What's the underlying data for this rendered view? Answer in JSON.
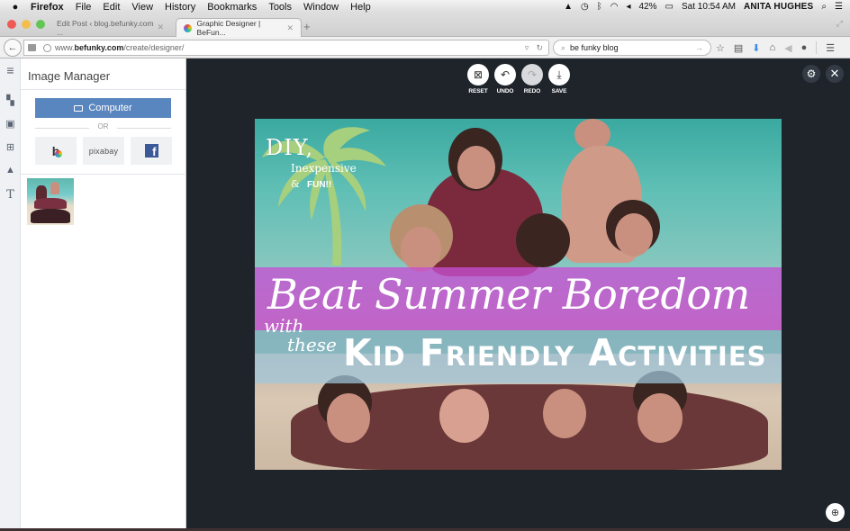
{
  "menubar": {
    "apple": "",
    "app": "Firefox",
    "items": [
      "File",
      "Edit",
      "View",
      "History",
      "Bookmarks",
      "Tools",
      "Window",
      "Help"
    ],
    "battery": "42%",
    "clock": "Sat 10:54 AM",
    "user": "ANITA HUGHES"
  },
  "tabs": [
    {
      "label": "Edit Post ‹ blog.befunky.com ...",
      "active": false
    },
    {
      "label": "Graphic Designer | BeFun...",
      "active": true
    }
  ],
  "navbar": {
    "url_prefix": "www.",
    "url_domain": "befunky.com",
    "url_path": "/create/designer/",
    "search_value": "be funky blog"
  },
  "sidebar": {
    "title": "Image Manager",
    "computer_label": "Computer",
    "or_label": "OR",
    "sources": [
      "BeFunky",
      "pixabay",
      "Facebook"
    ],
    "pixabay_label": "pixabay"
  },
  "toolbar": {
    "actions": [
      {
        "label": "RESET",
        "icon": "reset-icon",
        "enabled": true
      },
      {
        "label": "UNDO",
        "icon": "undo-icon",
        "enabled": true
      },
      {
        "label": "REDO",
        "icon": "redo-icon",
        "enabled": false
      },
      {
        "label": "SAVE",
        "icon": "save-icon",
        "enabled": true
      }
    ]
  },
  "design": {
    "diy": "DIY,",
    "inexpensive": "Inexpensive",
    "amp": "&",
    "fun": "FUN!!",
    "headline": "Beat Summer Boredom",
    "with": "with",
    "these": "these",
    "subhead": "Kid Friendly Activities",
    "colors": {
      "band_pink": "#c550d2",
      "band_blue": "#78b9c8",
      "palm": "#a6cf7e"
    }
  }
}
